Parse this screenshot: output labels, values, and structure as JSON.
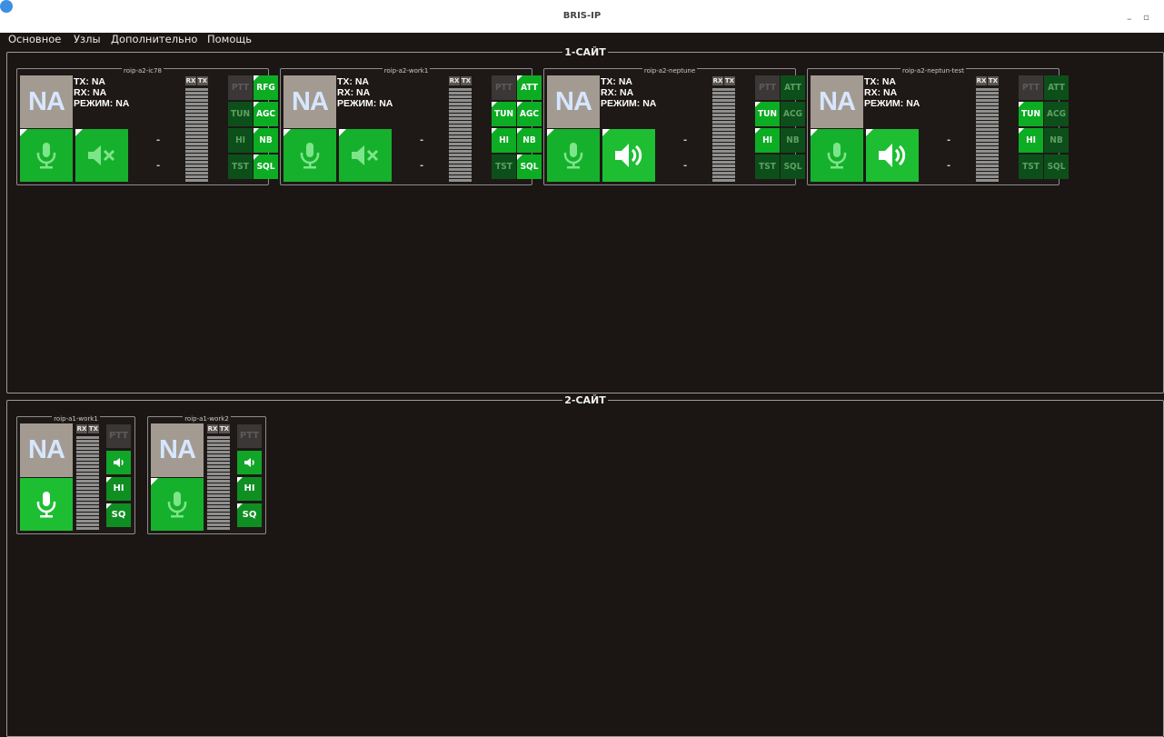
{
  "window": {
    "title": "BRIS-IP",
    "minimize": "–",
    "maximize": "▫"
  },
  "menu": {
    "items": [
      "Основное",
      "Узлы",
      "Дополнительно",
      "Помощь"
    ]
  },
  "sites": [
    {
      "title": "1-САЙТ",
      "nodes": [
        {
          "name": "roip-a2-ic78",
          "na": "NA",
          "tx": "TX: NA",
          "rx": "RX: NA",
          "mode": "РЕЖИМ: NA",
          "dash1": "-",
          "dash2": "-",
          "rx_label": "RX",
          "tx_label": "TX",
          "flags": [
            {
              "label": "PTT",
              "state": "off"
            },
            {
              "label": "RFG",
              "state": "on"
            },
            {
              "label": "TUN",
              "state": "dim"
            },
            {
              "label": "AGC",
              "state": "on"
            },
            {
              "label": "HI",
              "state": "dim"
            },
            {
              "label": "NB",
              "state": "on"
            },
            {
              "label": "TST",
              "state": "dim"
            },
            {
              "label": "SQL",
              "state": "on"
            }
          ],
          "speaker": "muted"
        },
        {
          "name": "roip-a2-work1",
          "na": "NA",
          "tx": "TX: NA",
          "rx": "RX: NA",
          "mode": "РЕЖИМ: NA",
          "dash1": "-",
          "dash2": "-",
          "rx_label": "RX",
          "tx_label": "TX",
          "flags": [
            {
              "label": "PTT",
              "state": "off"
            },
            {
              "label": "ATT",
              "state": "on"
            },
            {
              "label": "TUN",
              "state": "on"
            },
            {
              "label": "AGC",
              "state": "on"
            },
            {
              "label": "HI",
              "state": "on"
            },
            {
              "label": "NB",
              "state": "on"
            },
            {
              "label": "TST",
              "state": "dim"
            },
            {
              "label": "SQL",
              "state": "on"
            }
          ],
          "speaker": "muted"
        },
        {
          "name": "roip-a2-neptune",
          "na": "NA",
          "tx": "TX: NA",
          "rx": "RX: NA",
          "mode": "РЕЖИМ: NA",
          "dash1": "-",
          "dash2": "-",
          "rx_label": "RX",
          "tx_label": "TX",
          "flags": [
            {
              "label": "PTT",
              "state": "off"
            },
            {
              "label": "ATT",
              "state": "dim"
            },
            {
              "label": "TUN",
              "state": "on"
            },
            {
              "label": "ACG",
              "state": "dim"
            },
            {
              "label": "HI",
              "state": "on"
            },
            {
              "label": "NB",
              "state": "dim"
            },
            {
              "label": "TST",
              "state": "dim"
            },
            {
              "label": "SQL",
              "state": "dim"
            }
          ],
          "speaker": "on"
        },
        {
          "name": "roip-a2-neptun-test",
          "na": "NA",
          "tx": "TX: NA",
          "rx": "RX: NA",
          "mode": "РЕЖИМ: NA",
          "dash1": "-",
          "dash2": "-",
          "rx_label": "RX",
          "tx_label": "TX",
          "flags": [
            {
              "label": "PTT",
              "state": "off"
            },
            {
              "label": "ATT",
              "state": "dim"
            },
            {
              "label": "TUN",
              "state": "on"
            },
            {
              "label": "ACG",
              "state": "dim"
            },
            {
              "label": "HI",
              "state": "on"
            },
            {
              "label": "NB",
              "state": "dim"
            },
            {
              "label": "TST",
              "state": "dim"
            },
            {
              "label": "SQL",
              "state": "dim"
            }
          ],
          "speaker": "on"
        }
      ]
    },
    {
      "title": "2-САЙТ",
      "nodes": [
        {
          "name": "roip-a1-work1",
          "na": "NA",
          "rx_label": "RX",
          "tx_label": "TX",
          "ptt": "PTT",
          "hi": "HI",
          "sq": "SQ"
        },
        {
          "name": "roip-a1-work2",
          "na": "NA",
          "rx_label": "RX",
          "tx_label": "TX",
          "ptt": "PTT",
          "hi": "HI",
          "sq": "SQ"
        }
      ]
    }
  ],
  "colors": {
    "background": "#1b1614",
    "green": "#16b12c",
    "dark_green": "#0d4f1b",
    "na_gray": "#a39b92"
  }
}
